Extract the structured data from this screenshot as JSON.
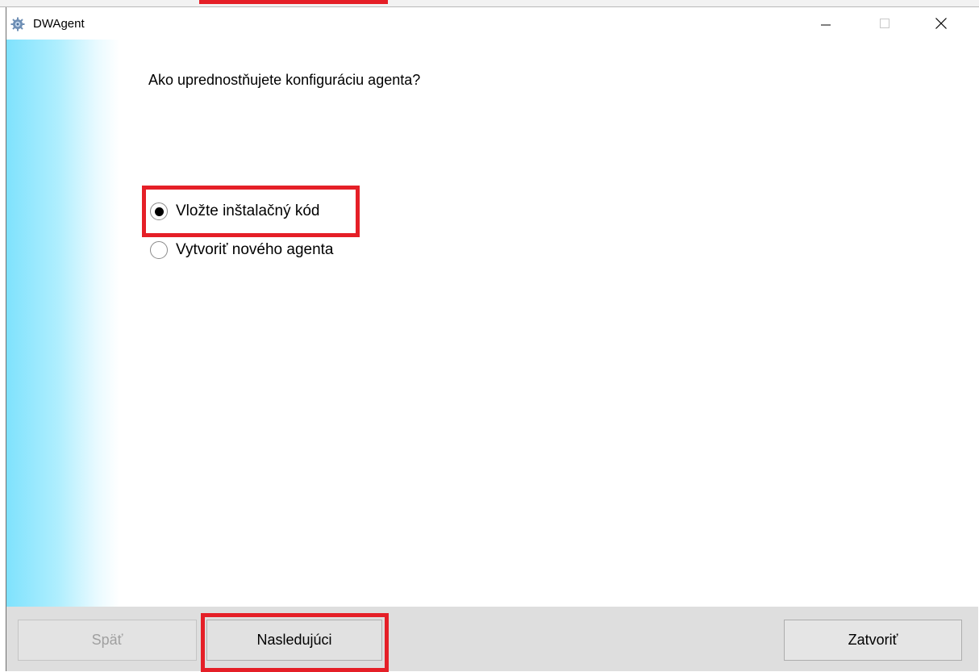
{
  "window": {
    "title": "DWAgent",
    "icon": "gear-icon"
  },
  "title_controls": {
    "minimize_icon": "minimize-icon",
    "maximize_icon": "maximize-icon",
    "close_icon": "close-icon"
  },
  "main": {
    "question": "Ako uprednostňujete konfiguráciu agenta?",
    "options": [
      {
        "label": "Vložte inštalačný kód",
        "selected": true
      },
      {
        "label": "Vytvoriť nového agenta",
        "selected": false
      }
    ]
  },
  "footer": {
    "back_label": "Späť",
    "back_enabled": false,
    "next_label": "Nasledujúci",
    "close_label": "Zatvoriť"
  },
  "colors": {
    "highlight": "#e51f27",
    "side_gradient_start": "#7fe2fd",
    "bottom_bar": "#dedede",
    "disabled_text": "#a0a0a0"
  }
}
